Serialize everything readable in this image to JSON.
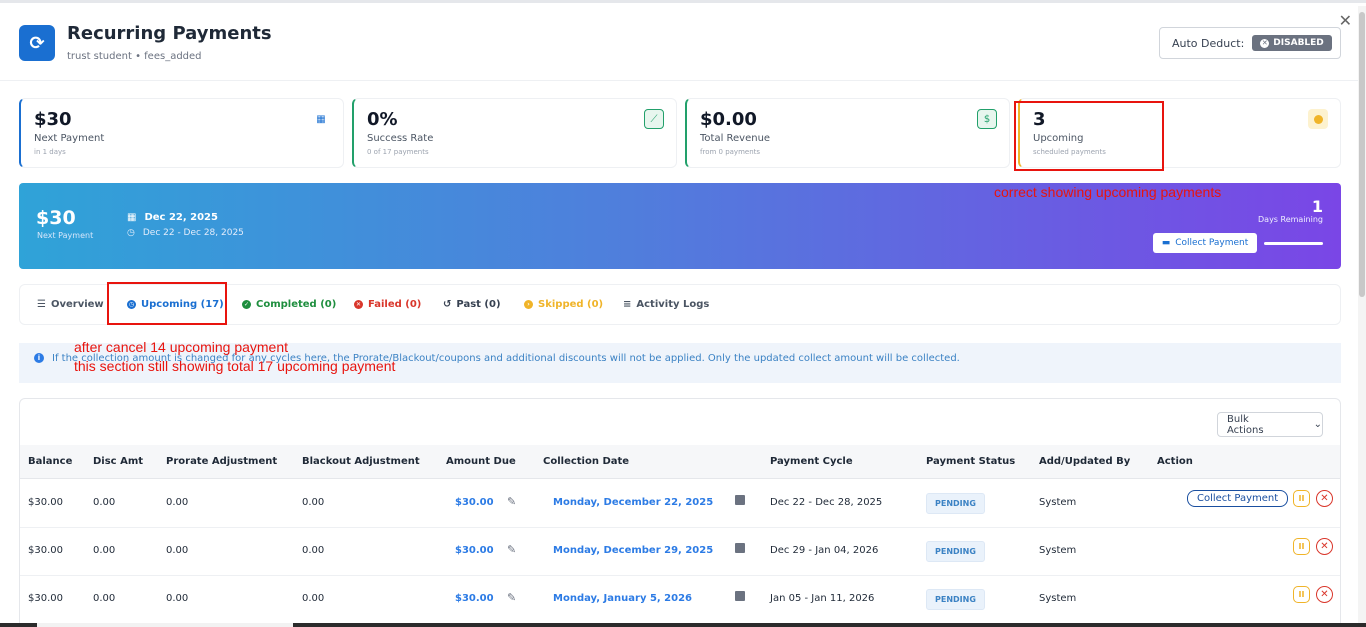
{
  "header": {
    "title": "Recurring Payments",
    "subtitle": "trust student • fees_added",
    "auto_deduct_label": "Auto Deduct:",
    "auto_deduct_status": "DISABLED",
    "close": "✕"
  },
  "stats": [
    {
      "value": "$30",
      "label": "Next Payment",
      "sub": "in 1 days",
      "icon": "calendar-icon"
    },
    {
      "value": "0%",
      "label": "Success Rate",
      "sub": "0 of 17 payments",
      "icon": "chart-icon"
    },
    {
      "value": "$0.00",
      "label": "Total Revenue",
      "sub": "from 0 payments",
      "icon": "dollar-icon"
    },
    {
      "value": "3",
      "label": "Upcoming",
      "sub": "scheduled payments",
      "icon": "clock-icon"
    }
  ],
  "banner": {
    "amount": "$30",
    "amount_label": "Next Payment",
    "date": "Dec 22, 2025",
    "range": "Dec 22 - Dec 28, 2025",
    "days": "1",
    "days_label": "Days Remaining",
    "collect_label": "Collect Payment"
  },
  "annotations": {
    "a1": "correct showing upcoming payments",
    "a2": "after cancel 14 upcoming payment",
    "a3": "this section still showing total 17 upcoming payment"
  },
  "tabs": [
    {
      "label": "Overview",
      "color": "#4b5563"
    },
    {
      "label": "Upcoming (17)",
      "color": "#1a6fd1"
    },
    {
      "label": "Completed (0)",
      "color": "#1e8e3e"
    },
    {
      "label": "Failed (0)",
      "color": "#d9362b"
    },
    {
      "label": "Past (0)",
      "color": "#374151"
    },
    {
      "label": "Skipped (0)",
      "color": "#f0b429"
    },
    {
      "label": "Activity Logs",
      "color": "#4b5563"
    }
  ],
  "info": "If the collection amount is changed for any cycles here, the Prorate/Blackout/coupons and additional discounts will not be applied. Only the updated collect amount will be collected.",
  "table": {
    "bulk_actions": "Bulk Actions",
    "columns": [
      "Balance",
      "Disc Amt",
      "Prorate Adjustment",
      "Blackout Adjustment",
      "Amount Due",
      "Collection Date",
      "Payment Cycle",
      "Payment Status",
      "Add/Updated By",
      "Action"
    ],
    "rows": [
      {
        "balance": "$30.00",
        "disc": "0.00",
        "prorate": "0.00",
        "blackout": "0.00",
        "due": "$30.00",
        "date": "Monday, December 22, 2025",
        "cycle": "Dec 22 - Dec 28, 2025",
        "status": "PENDING",
        "by": "System",
        "collect": "Collect Payment"
      },
      {
        "balance": "$30.00",
        "disc": "0.00",
        "prorate": "0.00",
        "blackout": "0.00",
        "due": "$30.00",
        "date": "Monday, December 29, 2025",
        "cycle": "Dec 29 - Jan 04, 2026",
        "status": "PENDING",
        "by": "System",
        "collect": ""
      },
      {
        "balance": "$30.00",
        "disc": "0.00",
        "prorate": "0.00",
        "blackout": "0.00",
        "due": "$30.00",
        "date": "Monday, January 5, 2026",
        "cycle": "Jan 05 - Jan 11, 2026",
        "status": "PENDING",
        "by": "System",
        "collect": ""
      }
    ]
  }
}
